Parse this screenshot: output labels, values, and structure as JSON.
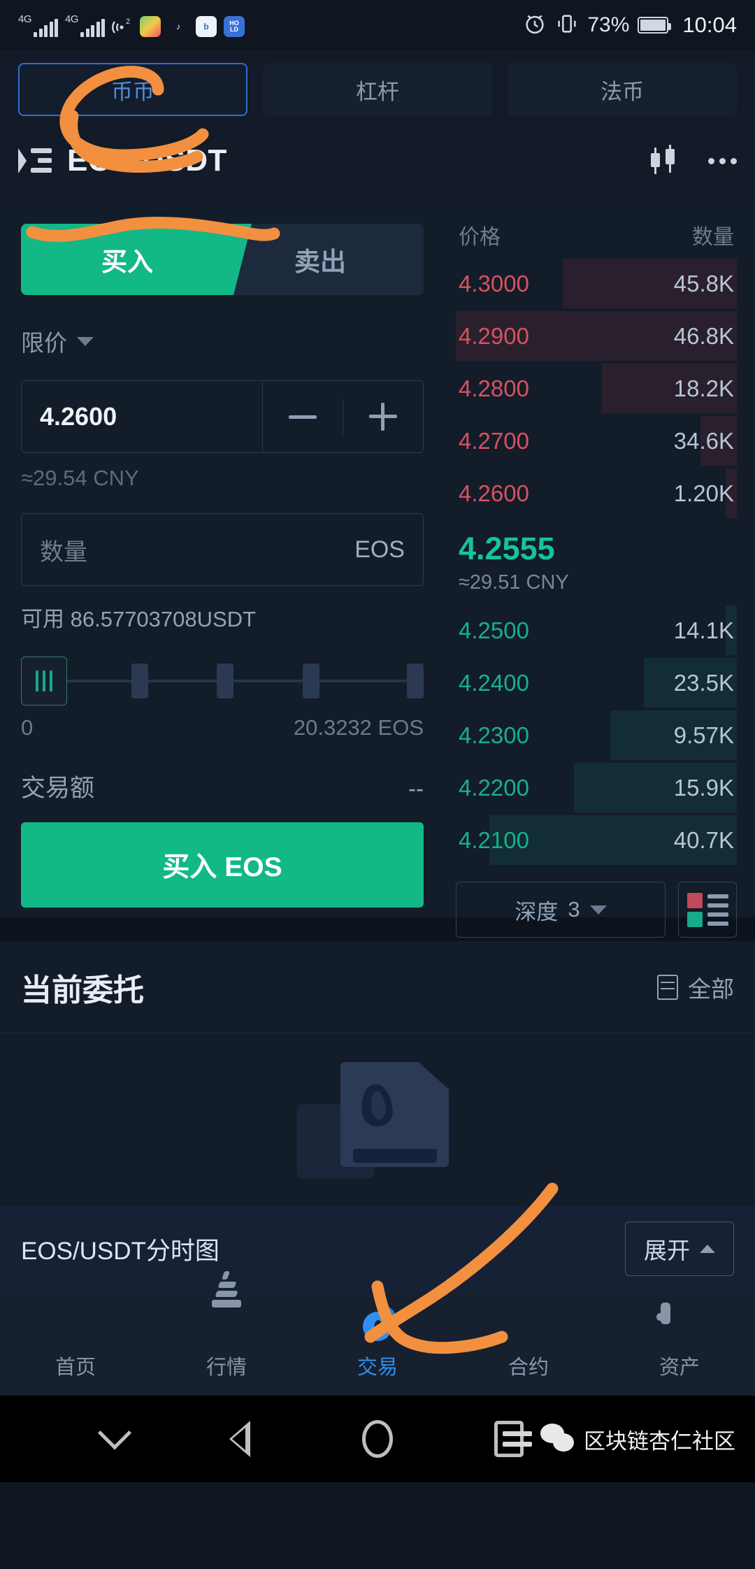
{
  "statusbar": {
    "network_1": "4G",
    "network_2": "4G",
    "notification_count": "2",
    "battery_percent": "73%",
    "time": "10:04",
    "icons": [
      "signal-icon",
      "signal-icon",
      "hotspot-icon",
      "video-app-icon",
      "tiktok-app-icon",
      "browser-app-icon",
      "hold-app-icon",
      "alarm-icon",
      "vibrate-icon",
      "battery-icon"
    ]
  },
  "market_tabs": [
    {
      "label": "币币",
      "active": true
    },
    {
      "label": "杠杆",
      "active": false
    },
    {
      "label": "法币",
      "active": false
    }
  ],
  "pair_header": {
    "title": "EOS/USDT",
    "list_icon": "market-list-icon",
    "chart_icon": "candlestick-chart-icon",
    "more_icon": "more-dots-icon"
  },
  "trade_form": {
    "buy_label": "买入",
    "sell_label": "卖出",
    "order_type": "限价",
    "price_value": "4.2600",
    "price_cny": "≈29.54 CNY",
    "amount_placeholder": "数量",
    "amount_unit": "EOS",
    "available_label": "可用 86.57703708USDT",
    "slider_min": "0",
    "slider_max": "20.3232 EOS",
    "total_label": "交易额",
    "total_value": "--",
    "submit_label": "买入 EOS"
  },
  "orderbook": {
    "col_price": "价格",
    "col_amount": "数量",
    "asks": [
      {
        "price": "4.3000",
        "amount": "45.8K",
        "depth": 62
      },
      {
        "price": "4.2900",
        "amount": "46.8K",
        "depth": 100
      },
      {
        "price": "4.2800",
        "amount": "18.2K",
        "depth": 48
      },
      {
        "price": "4.2700",
        "amount": "34.6K",
        "depth": 13
      },
      {
        "price": "4.2600",
        "amount": "1.20K",
        "depth": 4
      }
    ],
    "last_price": "4.2555",
    "last_price_cny": "≈29.51 CNY",
    "bids": [
      {
        "price": "4.2500",
        "amount": "14.1K",
        "depth": 4
      },
      {
        "price": "4.2400",
        "amount": "23.5K",
        "depth": 33
      },
      {
        "price": "4.2300",
        "amount": "9.57K",
        "depth": 45
      },
      {
        "price": "4.2200",
        "amount": "15.9K",
        "depth": 58
      },
      {
        "price": "4.2100",
        "amount": "40.7K",
        "depth": 88
      }
    ],
    "depth_label": "深度",
    "depth_value": "3",
    "layout_icon": "orderbook-layout-icon"
  },
  "orders_section": {
    "title": "当前委托",
    "filter_label": "全部",
    "filter_icon": "list-filter-icon",
    "empty_icon": "empty-orders-icon"
  },
  "chart_bar": {
    "label": "EOS/USDT分时图",
    "expand_label": "展开"
  },
  "bottom_nav": [
    {
      "label": "首页",
      "icon": "flame-icon",
      "active": false
    },
    {
      "label": "行情",
      "icon": "market-trend-icon",
      "active": false
    },
    {
      "label": "交易",
      "icon": "trade-icon",
      "active": true
    },
    {
      "label": "合约",
      "icon": "contract-icon",
      "active": false
    },
    {
      "label": "资产",
      "icon": "assets-icon",
      "active": false
    }
  ],
  "android_nav": {
    "icons": [
      "chevron-down-icon",
      "back-icon",
      "home-icon",
      "recents-icon"
    ],
    "watermark_text": "区块链杏仁社区"
  },
  "colors": {
    "buy_green": "#12b886",
    "ask_red": "#d8515f",
    "bid_green": "#16b18c",
    "accent_blue": "#2f8ff0",
    "annotation_orange": "#f29040"
  }
}
